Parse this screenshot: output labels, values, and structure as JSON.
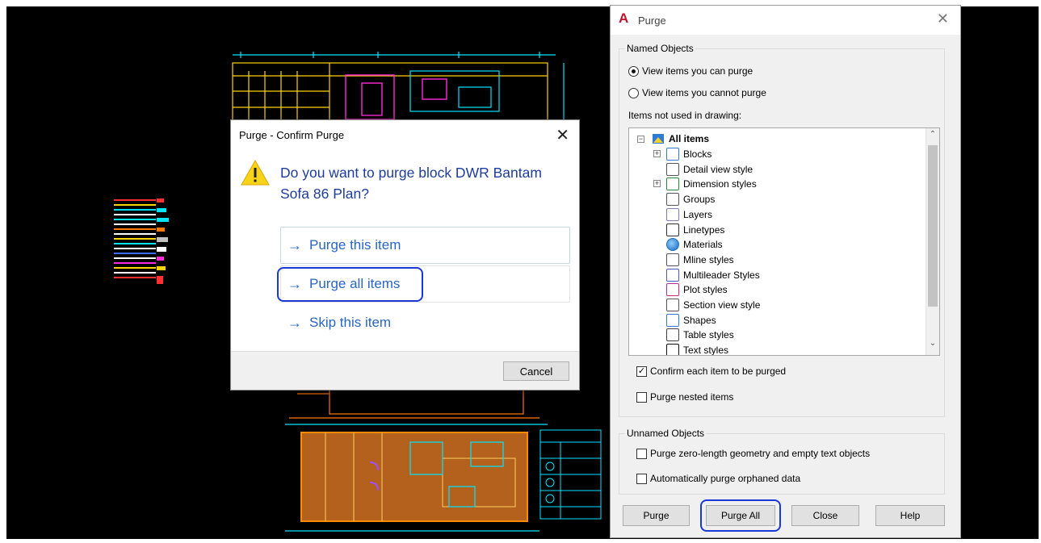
{
  "confirm_dialog": {
    "title": "Purge - Confirm Purge",
    "close_symbol": "✕",
    "question": "Do you want to purge block DWR Bantam Sofa 86 Plan?",
    "commands": [
      {
        "label": "Purge this item"
      },
      {
        "label": "Purge all items"
      },
      {
        "label": "Skip this item"
      }
    ],
    "cancel_label": "Cancel",
    "icon": "warning-icon"
  },
  "purge_dialog": {
    "title": "Purge",
    "app_icon": "autocad-a-icon",
    "close_symbol": "✕",
    "named_group_label": "Named Objects",
    "radio_can": "View items you can purge",
    "radio_cannot": "View items you cannot purge",
    "radio_selected": "can",
    "tree_label": "Items not used in drawing:",
    "tree_root": "All items",
    "tree_items": [
      {
        "label": "Blocks",
        "icon": "blocks-icon",
        "expandable": true
      },
      {
        "label": "Detail view style",
        "icon": "detail-view-icon",
        "expandable": false
      },
      {
        "label": "Dimension styles",
        "icon": "dimension-icon",
        "expandable": true
      },
      {
        "label": "Groups",
        "icon": "groups-icon",
        "expandable": false
      },
      {
        "label": "Layers",
        "icon": "layers-icon",
        "expandable": false
      },
      {
        "label": "Linetypes",
        "icon": "linetypes-icon",
        "expandable": false
      },
      {
        "label": "Materials",
        "icon": "materials-icon",
        "expandable": false
      },
      {
        "label": "Mline styles",
        "icon": "mline-icon",
        "expandable": false
      },
      {
        "label": "Multileader Styles",
        "icon": "multileader-icon",
        "expandable": false
      },
      {
        "label": "Plot styles",
        "icon": "plot-styles-icon",
        "expandable": false
      },
      {
        "label": "Section view style",
        "icon": "section-view-icon",
        "expandable": false
      },
      {
        "label": "Shapes",
        "icon": "shapes-icon",
        "expandable": false
      },
      {
        "label": "Table styles",
        "icon": "table-styles-icon",
        "expandable": false
      },
      {
        "label": "Text styles",
        "icon": "text-styles-icon",
        "expandable": false
      }
    ],
    "confirm_each": {
      "label": "Confirm each item to be purged",
      "checked": true
    },
    "purge_nested": {
      "label": "Purge nested items",
      "checked": false
    },
    "unnamed_group_label": "Unnamed Objects",
    "zero_length": {
      "label": "Purge zero-length geometry and empty text objects",
      "checked": false
    },
    "orphaned": {
      "label": "Automatically purge orphaned data",
      "checked": false
    },
    "buttons": {
      "purge": "Purge",
      "purge_all": "Purge All",
      "close": "Close",
      "help": "Help"
    }
  },
  "colors": {
    "accent_link": "#2866c6",
    "question_text": "#1e3c9c",
    "highlight_ring": "#1c37d8",
    "cad_background": "#000000"
  }
}
